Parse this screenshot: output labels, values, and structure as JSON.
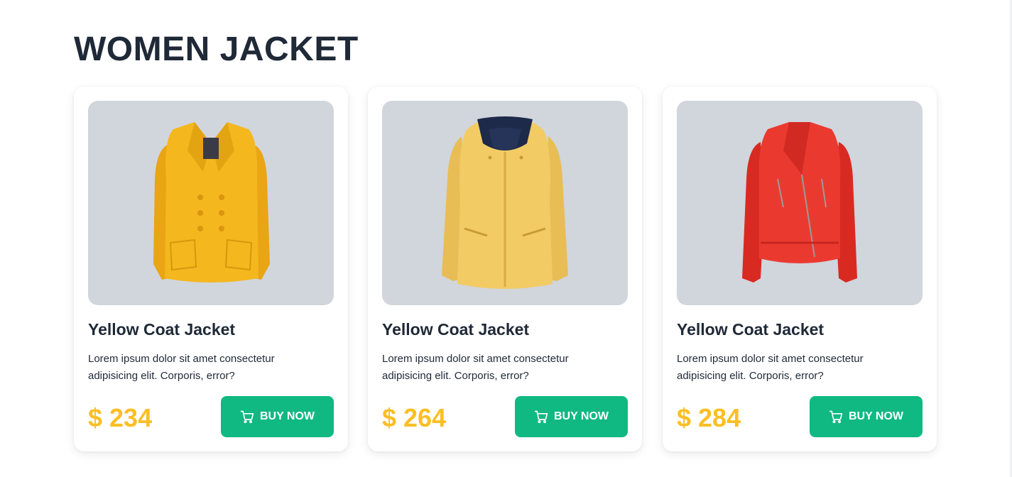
{
  "page": {
    "title": "WOMEN JACKET"
  },
  "colors": {
    "accent": "#10b981",
    "price": "#fbbf24",
    "image_bg": "#d1d5dc",
    "text": "#1f2937"
  },
  "products": [
    {
      "image_icon": "yellow-coat-jacket-image",
      "title": "Yellow Coat Jacket",
      "description": "Lorem ipsum dolor sit amet consectetur adipisicing elit. Corporis, error?",
      "price": "$ 234",
      "button_label": "BUY NOW",
      "button_icon": "cart-icon"
    },
    {
      "image_icon": "yellow-hooded-jacket-image",
      "title": "Yellow Coat Jacket",
      "description": "Lorem ipsum dolor sit amet consectetur adipisicing elit. Corporis, error?",
      "price": "$ 264",
      "button_label": "BUY NOW",
      "button_icon": "cart-icon"
    },
    {
      "image_icon": "red-leather-jacket-image",
      "title": "Yellow Coat Jacket",
      "description": "Lorem ipsum dolor sit amet consectetur adipisicing elit. Corporis, error?",
      "price": "$ 284",
      "button_label": "BUY NOW",
      "button_icon": "cart-icon"
    }
  ]
}
